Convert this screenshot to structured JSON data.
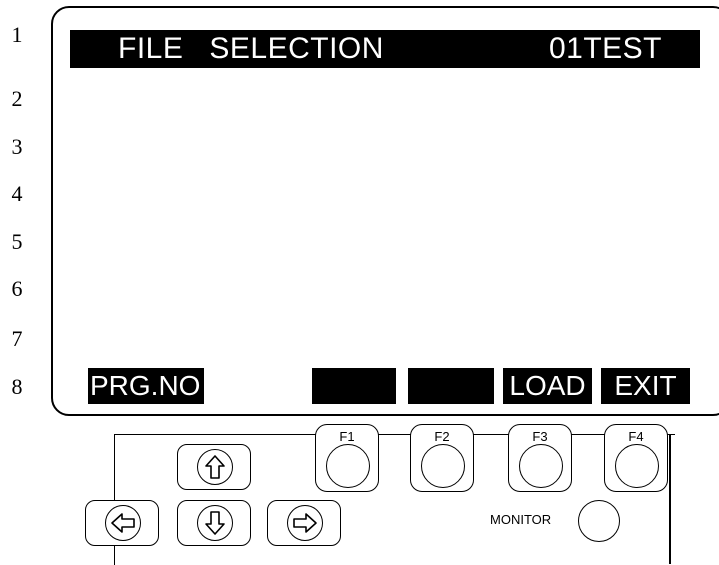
{
  "line_numbers": [
    "1",
    "2",
    "3",
    "4",
    "5",
    "6",
    "7",
    "8"
  ],
  "screen": {
    "title_words": [
      "FILE",
      "SELECTION"
    ],
    "file_name": "01TEST"
  },
  "softkeys": {
    "prg_no": "PRG.NO",
    "blank1": "",
    "blank2": "",
    "load": "LOAD",
    "exit": "EXIT"
  },
  "function_keys": [
    "F1",
    "F2",
    "F3",
    "F4"
  ],
  "arrow_keys": [
    "up-arrow-icon",
    "left-arrow-icon",
    "down-arrow-icon",
    "right-arrow-icon"
  ],
  "monitor_label": "MONITOR"
}
